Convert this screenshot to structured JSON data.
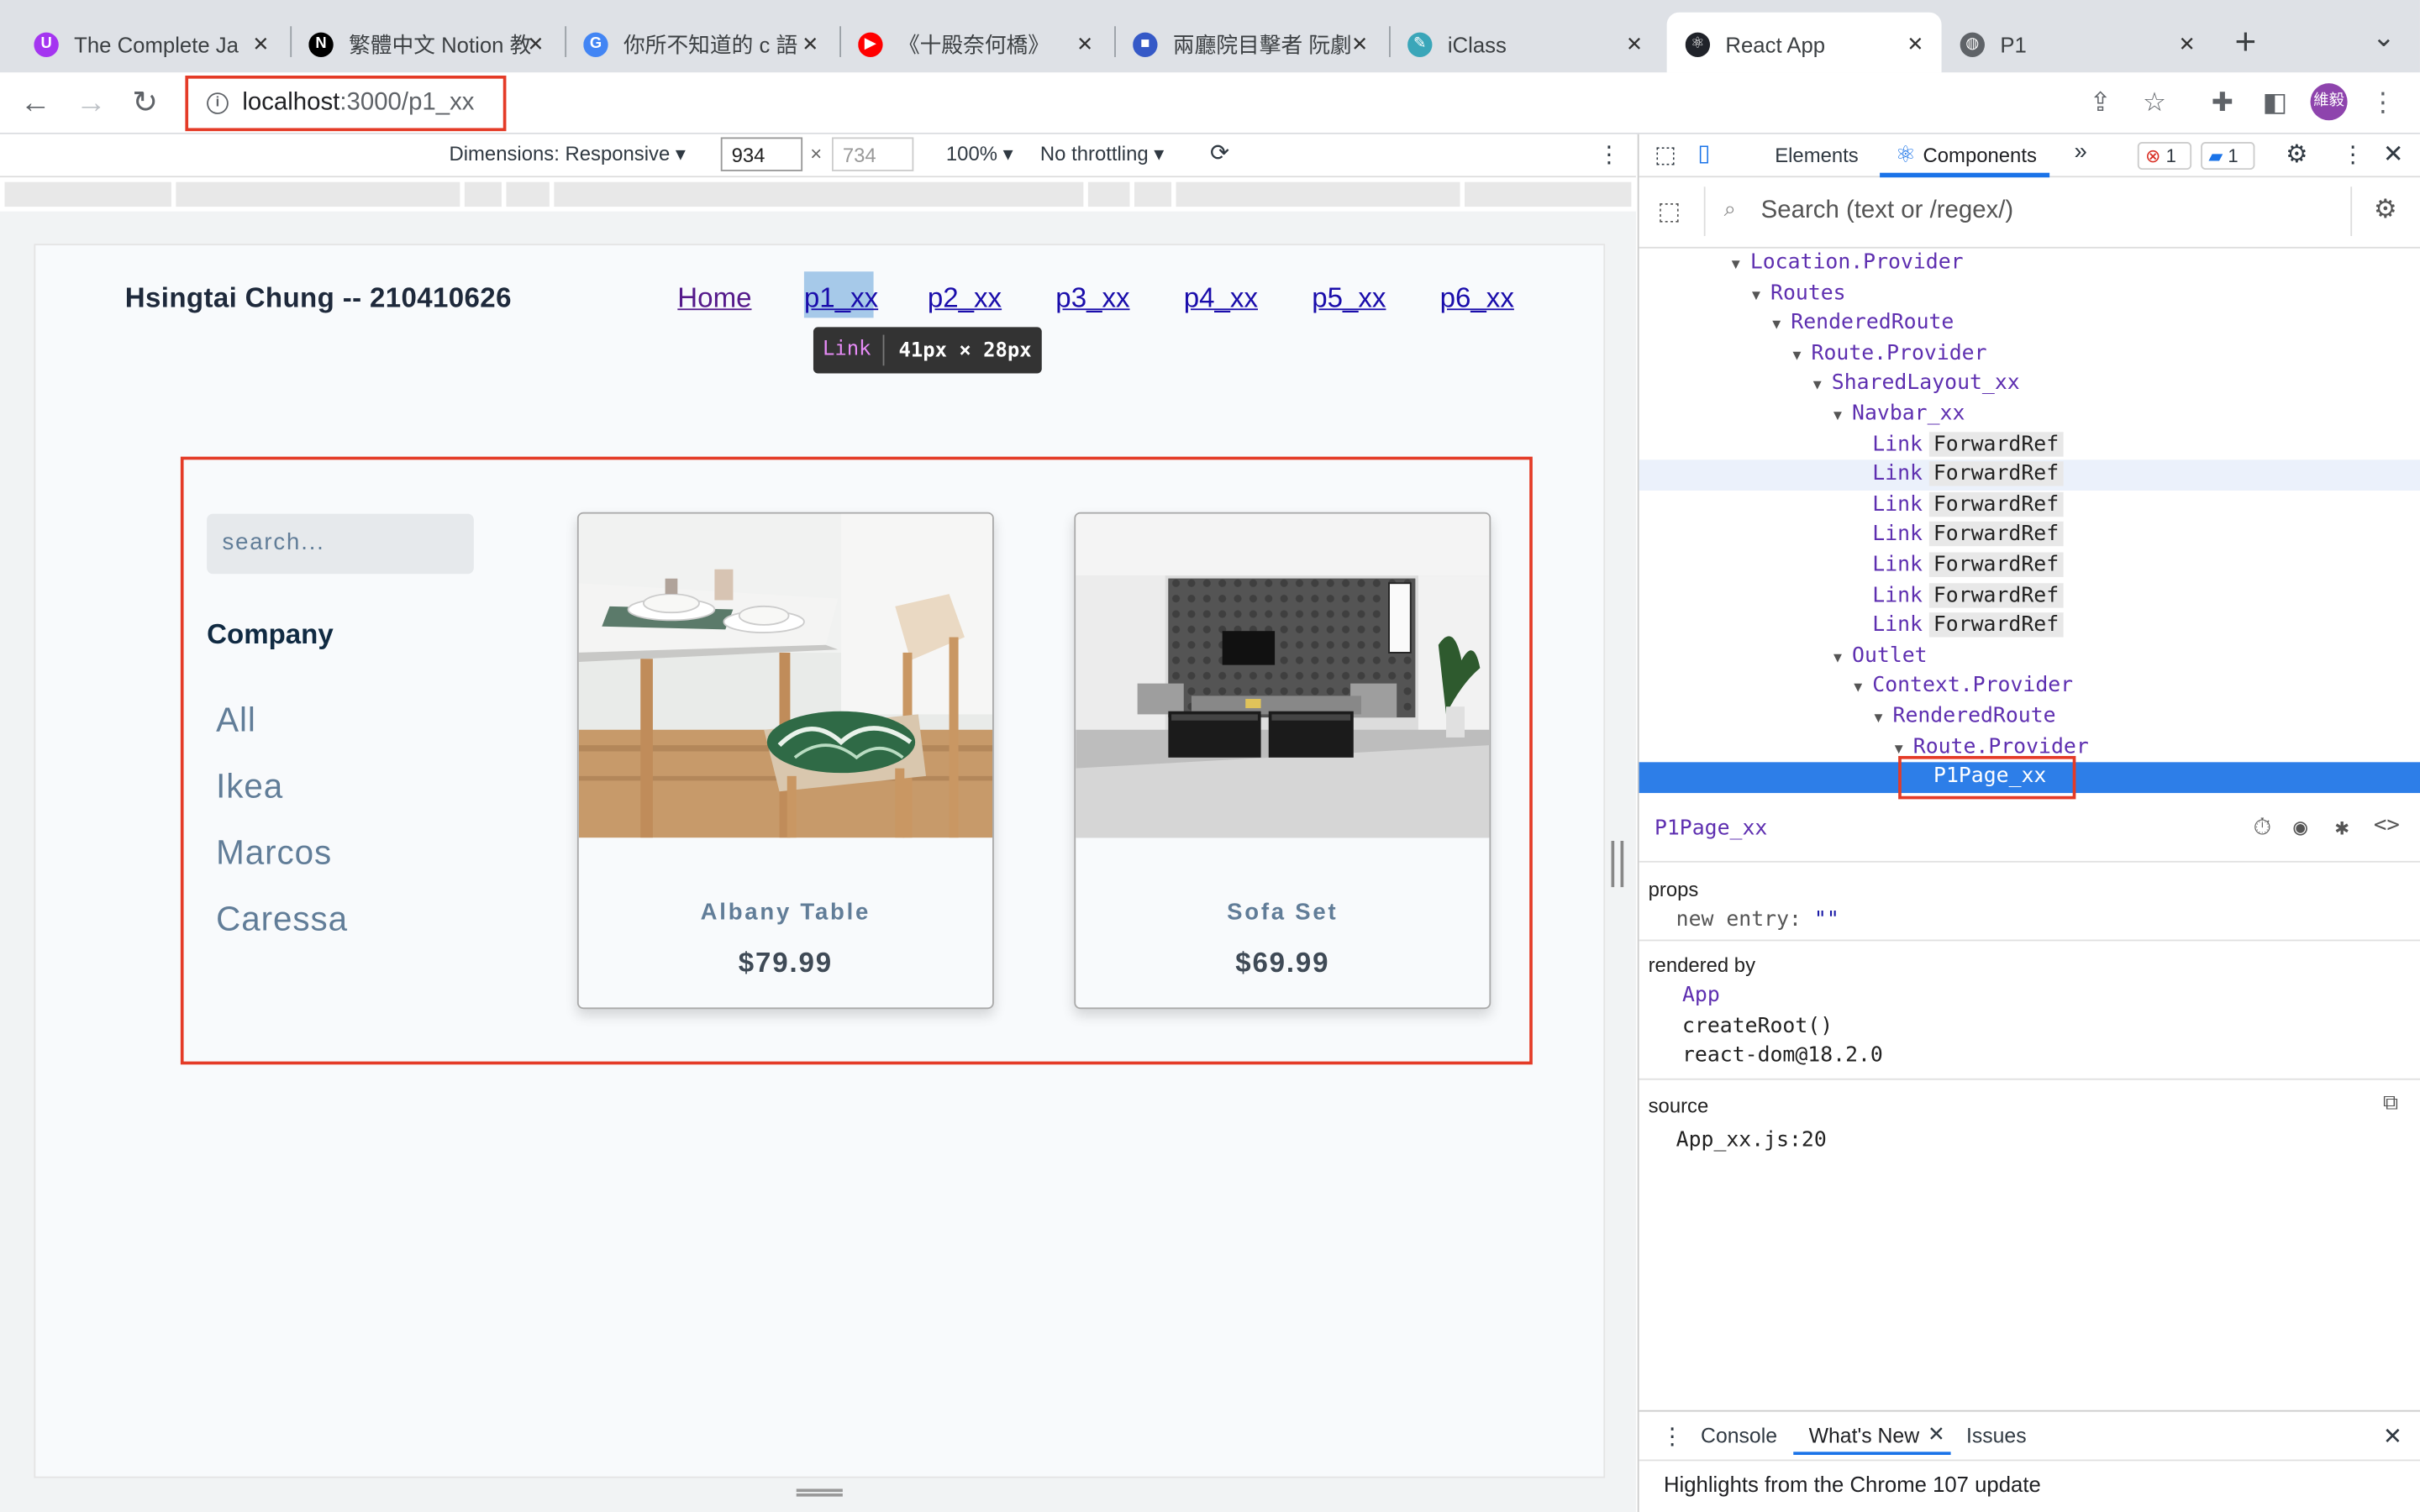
{
  "browser": {
    "tabs": [
      {
        "title": "The Complete Ja",
        "icon": "udemy-icon",
        "color": "#a435f0",
        "glyph": "U"
      },
      {
        "title": "繁體中文 Notion 教",
        "icon": "notion-icon",
        "color": "#000000",
        "glyph": "N"
      },
      {
        "title": "你所不知道的 c 語",
        "icon": "google-icon",
        "color": "#4285f4",
        "glyph": "G"
      },
      {
        "title": "《十殿奈何橋》",
        "icon": "youtube-icon",
        "color": "#ff0000",
        "glyph": "▶"
      },
      {
        "title": "兩廳院目擊者 阮劇",
        "icon": "chat-icon",
        "color": "#3559c7",
        "glyph": "■"
      },
      {
        "title": "iClass",
        "icon": "iclass-icon",
        "color": "#3aa6b9",
        "glyph": "✎"
      },
      {
        "title": "React App",
        "icon": "react-icon",
        "color": "#20232a",
        "glyph": "⚛"
      },
      {
        "title": "P1",
        "icon": "globe-icon",
        "color": "#5f6368",
        "glyph": "◍"
      }
    ],
    "new_tab": "+",
    "tab_menu": "⌄",
    "url_host": "localhost",
    "url_path": ":3000/p1_xx",
    "profile": "維毅"
  },
  "devtoolbar": {
    "dimensions": "Dimensions: Responsive",
    "width": "934",
    "height": "734",
    "times": "×",
    "zoom": "100%",
    "throttling": "No throttling"
  },
  "app": {
    "brand": "Hsingtai Chung -- 210410626",
    "nav": [
      "Home",
      "p1_xx",
      "p2_xx",
      "p3_xx",
      "p4_xx",
      "p5_xx",
      "p6_xx"
    ],
    "inspect_tooltip": {
      "name": "Link",
      "dims": "41px × 28px"
    },
    "search_placeholder": "search...",
    "company_heading": "Company",
    "companies": [
      "All",
      "Ikea",
      "Marcos",
      "Caressa"
    ],
    "products": [
      {
        "name": "Albany Table",
        "price": "$79.99"
      },
      {
        "name": "Sofa Set",
        "price": "$69.99"
      }
    ]
  },
  "devtools": {
    "tabs": {
      "elements": "Elements",
      "components": "Components",
      "more": "»"
    },
    "errors": "1",
    "messages": "1",
    "search_placeholder": "Search (text or /regex/)",
    "tree": [
      {
        "name": "Location.Provider",
        "depth": 0
      },
      {
        "name": "Routes",
        "depth": 1
      },
      {
        "name": "RenderedRoute",
        "depth": 2
      },
      {
        "name": "Route.Provider",
        "depth": 3
      },
      {
        "name": "SharedLayout_xx",
        "depth": 4
      },
      {
        "name": "Navbar_xx",
        "depth": 5
      },
      {
        "name": "Link",
        "key": "ForwardRef",
        "depth": 6
      },
      {
        "name": "Link",
        "key": "ForwardRef",
        "depth": 6
      },
      {
        "name": "Link",
        "key": "ForwardRef",
        "depth": 6
      },
      {
        "name": "Link",
        "key": "ForwardRef",
        "depth": 6
      },
      {
        "name": "Link",
        "key": "ForwardRef",
        "depth": 6
      },
      {
        "name": "Link",
        "key": "ForwardRef",
        "depth": 6
      },
      {
        "name": "Link",
        "key": "ForwardRef",
        "depth": 6
      },
      {
        "name": "Outlet",
        "depth": 5
      },
      {
        "name": "Context.Provider",
        "depth": 6
      },
      {
        "name": "RenderedRoute",
        "depth": 7
      },
      {
        "name": "Route.Provider",
        "depth": 8
      },
      {
        "name": "P1Page_xx",
        "depth": 9
      }
    ],
    "selected": {
      "name": "P1Page_xx",
      "props_label": "props",
      "prop_key": "new entry",
      "prop_value": "\"\"",
      "rendered_by_label": "rendered by",
      "rendered_by": [
        "App",
        "createRoot()",
        "react-dom@18.2.0"
      ],
      "source_label": "source",
      "source": "App_xx.js:20"
    },
    "drawer": {
      "tabs": [
        "Console",
        "What's New",
        "Issues"
      ],
      "message": "Highlights from the Chrome 107 update"
    }
  }
}
